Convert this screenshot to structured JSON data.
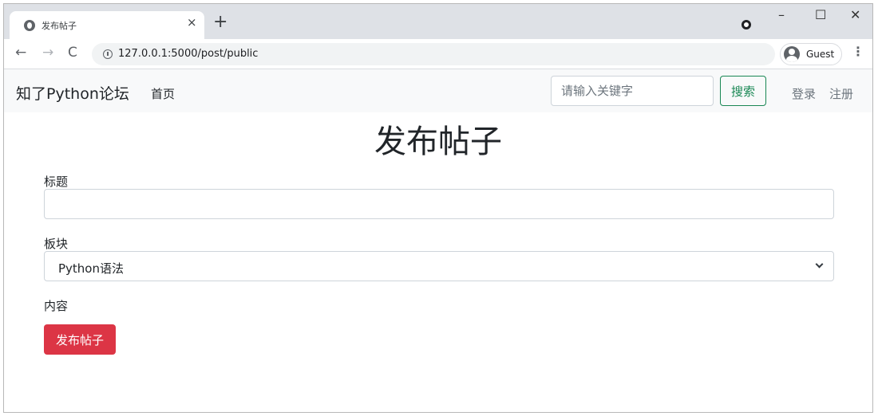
{
  "browser": {
    "tab_title": "发布帖子",
    "tab_close": "×",
    "new_tab": "+",
    "url": "127.0.0.1:5000/post/public",
    "profile_label": "Guest",
    "window_controls": {
      "minimize": "–",
      "maximize": "☐",
      "close": "✕"
    },
    "nav": {
      "back": "←",
      "forward": "→",
      "reload": "C"
    },
    "menu": "⋮"
  },
  "navbar": {
    "brand": "知了Python论坛",
    "home": "首页",
    "search_placeholder": "请输入关键字",
    "search_button": "搜索",
    "login": "登录",
    "register": "注册"
  },
  "form": {
    "page_title": "发布帖子",
    "title_label": "标题",
    "title_value": "",
    "board_label": "板块",
    "board_selected": "Python语法",
    "content_label": "内容",
    "submit_label": "发布帖子"
  },
  "colors": {
    "primary_danger": "#dc3545",
    "success": "#198754",
    "navbar_bg": "#f8f9fa",
    "muted_text": "#6c757d"
  },
  "icons": {
    "tab_icon": "globe-icon",
    "info_icon": "info-icon",
    "profile_icon": "account-icon",
    "select_icon": "chevron-down-icon"
  }
}
